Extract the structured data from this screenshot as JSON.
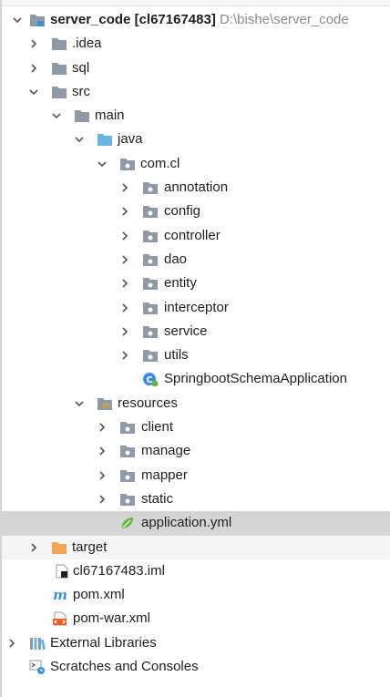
{
  "tree": {
    "root": {
      "name": "server_code",
      "module": "[cl67167483]",
      "path": "D:\\bishe\\server_code"
    },
    "items": [
      {
        "label": ".idea"
      },
      {
        "label": "sql"
      },
      {
        "label": "src"
      },
      {
        "label": "main"
      },
      {
        "label": "java"
      },
      {
        "label": "com.cl"
      },
      {
        "label": "annotation"
      },
      {
        "label": "config"
      },
      {
        "label": "controller"
      },
      {
        "label": "dao"
      },
      {
        "label": "entity"
      },
      {
        "label": "interceptor"
      },
      {
        "label": "service"
      },
      {
        "label": "utils"
      },
      {
        "label": "SpringbootSchemaApplication"
      },
      {
        "label": "resources"
      },
      {
        "label": "client"
      },
      {
        "label": "manage"
      },
      {
        "label": "mapper"
      },
      {
        "label": "static"
      },
      {
        "label": "application.yml"
      },
      {
        "label": "target"
      },
      {
        "label": "cl67167483.iml"
      },
      {
        "label": "pom.xml"
      },
      {
        "label": "pom-war.xml"
      },
      {
        "label": "External Libraries"
      },
      {
        "label": "Scratches and Consoles"
      }
    ]
  },
  "colors": {
    "folder": "#8e9aa6",
    "source_folder": "#6bb6e0",
    "excluded_folder": "#f0a75a",
    "selection": "#d5d5d5",
    "arrow": "#555555",
    "spring": "#6db33f"
  }
}
